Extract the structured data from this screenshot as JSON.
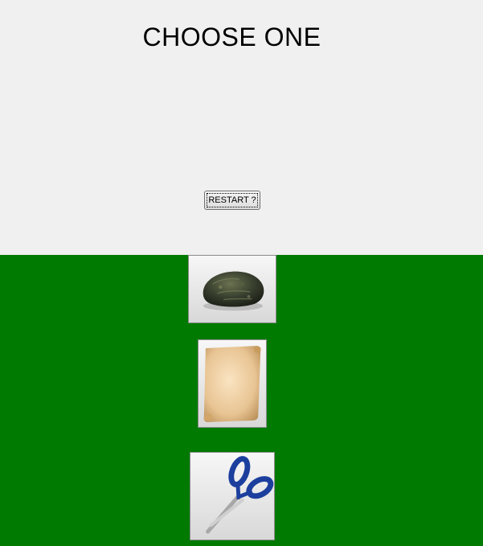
{
  "header": {
    "title": "CHOOSE ONE"
  },
  "controls": {
    "restart_label": "RESTART ?"
  },
  "choices": [
    {
      "id": "rock",
      "icon": "rock-icon"
    },
    {
      "id": "paper",
      "icon": "paper-scroll-icon"
    },
    {
      "id": "scissors",
      "icon": "scissors-icon"
    }
  ],
  "colors": {
    "top_background": "#f0f0f0",
    "board_background": "#007a00"
  }
}
